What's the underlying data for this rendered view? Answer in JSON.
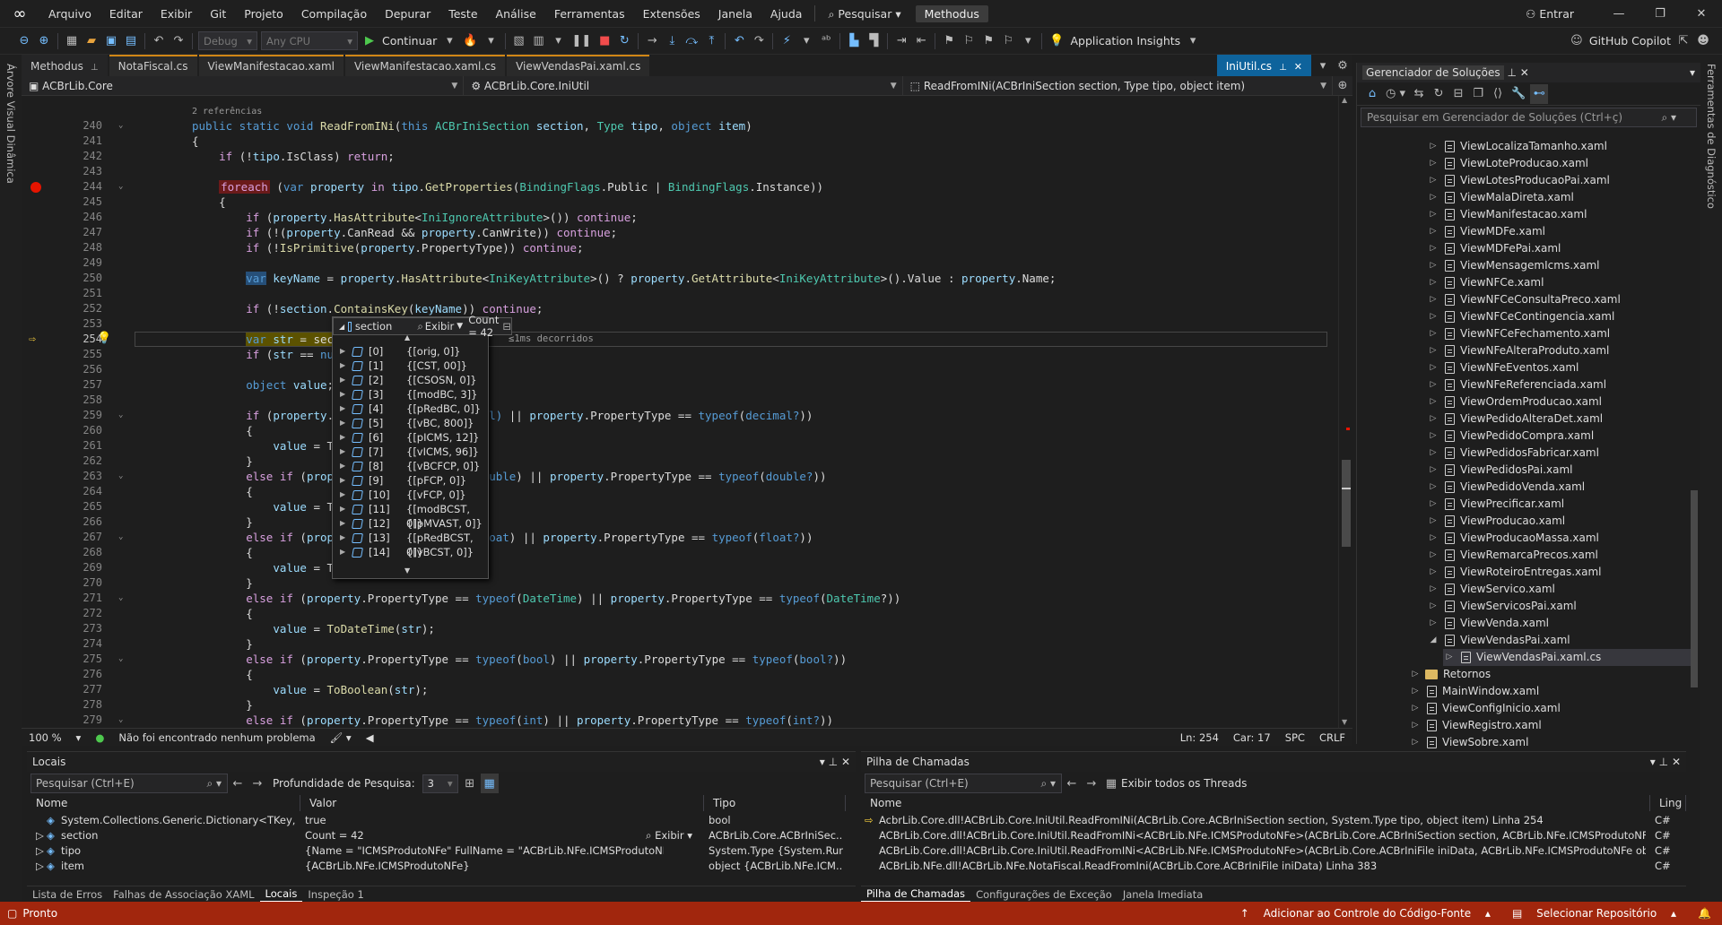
{
  "menu": {
    "items": [
      "Arquivo",
      "Editar",
      "Exibir",
      "Git",
      "Projeto",
      "Compilação",
      "Depurar",
      "Teste",
      "Análise",
      "Ferramentas",
      "Extensões",
      "Janela",
      "Ajuda"
    ],
    "search": "Pesquisar",
    "solution": "Methodus",
    "signin": "Entrar"
  },
  "toolbar": {
    "config": "Debug",
    "platform": "Any CPU",
    "continue": "Continuar",
    "insights": "Application Insights",
    "copilot": "GitHub Copilot"
  },
  "rails": {
    "left": "Árvore Visual Dinâmica",
    "right": "Ferramentas de Diagnóstico"
  },
  "tabs": [
    {
      "label": "Methodus",
      "style": "plain",
      "pin": "⊥"
    },
    {
      "label": "NotaFiscal.cs",
      "style": "orange"
    },
    {
      "label": "ViewManifestacao.xaml",
      "style": "orange"
    },
    {
      "label": "ViewManifestacao.xaml.cs",
      "style": "orange"
    },
    {
      "label": "ViewVendasPai.xaml.cs",
      "style": "orange"
    }
  ],
  "active_tab": {
    "label": "IniUtil.cs"
  },
  "navbar": {
    "project": "ACBrLib.Core",
    "class": "ACBrLib.Core.IniUtil",
    "member": "ReadFromINi(ACBrIniSection section, Type tipo, object item)"
  },
  "code": {
    "codelens": "2 referências",
    "elapsed": "≤1ms decorridos",
    "lines": [
      "240",
      "241",
      "242",
      "243",
      "244",
      "245",
      "246",
      "247",
      "248",
      "249",
      "250",
      "251",
      "252",
      "253",
      "254",
      "255",
      "256",
      "257",
      "258",
      "259",
      "260",
      "261",
      "262",
      "263",
      "264",
      "265",
      "266",
      "267",
      "268",
      "269",
      "270",
      "271",
      "272",
      "273",
      "274",
      "275",
      "276",
      "277",
      "278",
      "279"
    ]
  },
  "datatip": {
    "name": "section",
    "view": "Exibir",
    "count": "Count = 42",
    "items": [
      {
        "i": "[0]",
        "v": "{[orig, 0]}"
      },
      {
        "i": "[1]",
        "v": "{[CST, 00]}"
      },
      {
        "i": "[2]",
        "v": "{[CSOSN, 0]}"
      },
      {
        "i": "[3]",
        "v": "{[modBC, 3]}"
      },
      {
        "i": "[4]",
        "v": "{[pRedBC, 0]}"
      },
      {
        "i": "[5]",
        "v": "{[vBC, 800]}"
      },
      {
        "i": "[6]",
        "v": "{[pICMS, 12]}"
      },
      {
        "i": "[7]",
        "v": "{[vICMS, 96]}"
      },
      {
        "i": "[8]",
        "v": "{[vBCFCP, 0]}"
      },
      {
        "i": "[9]",
        "v": "{[pFCP, 0]}"
      },
      {
        "i": "[10]",
        "v": "{[vFCP, 0]}"
      },
      {
        "i": "[11]",
        "v": "{[modBCST, 0]}"
      },
      {
        "i": "[12]",
        "v": "{[pMVAST, 0]}"
      },
      {
        "i": "[13]",
        "v": "{[pRedBCST, 0]}"
      },
      {
        "i": "[14]",
        "v": "{[vBCST, 0]}"
      }
    ]
  },
  "editor_status": {
    "zoom": "100 %",
    "problems": "Não foi encontrado nenhum problema",
    "ln": "Ln: 254",
    "car": "Car: 17",
    "spc": "SPC",
    "crlf": "CRLF"
  },
  "solution": {
    "title": "Gerenciador de Soluções",
    "search": "Pesquisar em Gerenciador de Soluções (Ctrl+ç)",
    "items": [
      {
        "label": "ViewLocalizaTamanho.xaml",
        "lvl": 1,
        "kind": "file"
      },
      {
        "label": "ViewLoteProducao.xaml",
        "lvl": 1,
        "kind": "file"
      },
      {
        "label": "ViewLotesProducaoPai.xaml",
        "lvl": 1,
        "kind": "file"
      },
      {
        "label": "ViewMalaDireta.xaml",
        "lvl": 1,
        "kind": "file"
      },
      {
        "label": "ViewManifestacao.xaml",
        "lvl": 1,
        "kind": "file"
      },
      {
        "label": "ViewMDFe.xaml",
        "lvl": 1,
        "kind": "file"
      },
      {
        "label": "ViewMDFePai.xaml",
        "lvl": 1,
        "kind": "file"
      },
      {
        "label": "ViewMensagemIcms.xaml",
        "lvl": 1,
        "kind": "file"
      },
      {
        "label": "ViewNFCe.xaml",
        "lvl": 1,
        "kind": "file"
      },
      {
        "label": "ViewNFCeConsultaPreco.xaml",
        "lvl": 1,
        "kind": "file"
      },
      {
        "label": "ViewNFCeContingencia.xaml",
        "lvl": 1,
        "kind": "file"
      },
      {
        "label": "ViewNFCeFechamento.xaml",
        "lvl": 1,
        "kind": "file"
      },
      {
        "label": "ViewNFeAlteraProduto.xaml",
        "lvl": 1,
        "kind": "file"
      },
      {
        "label": "ViewNFeEventos.xaml",
        "lvl": 1,
        "kind": "file"
      },
      {
        "label": "ViewNFeReferenciada.xaml",
        "lvl": 1,
        "kind": "file"
      },
      {
        "label": "ViewOrdemProducao.xaml",
        "lvl": 1,
        "kind": "file"
      },
      {
        "label": "ViewPedidoAlteraDet.xaml",
        "lvl": 1,
        "kind": "file"
      },
      {
        "label": "ViewPedidoCompra.xaml",
        "lvl": 1,
        "kind": "file"
      },
      {
        "label": "ViewPedidosFabricar.xaml",
        "lvl": 1,
        "kind": "file"
      },
      {
        "label": "ViewPedidosPai.xaml",
        "lvl": 1,
        "kind": "file"
      },
      {
        "label": "ViewPedidoVenda.xaml",
        "lvl": 1,
        "kind": "file"
      },
      {
        "label": "ViewPrecificar.xaml",
        "lvl": 1,
        "kind": "file"
      },
      {
        "label": "ViewProducao.xaml",
        "lvl": 1,
        "kind": "file"
      },
      {
        "label": "ViewProducaoMassa.xaml",
        "lvl": 1,
        "kind": "file"
      },
      {
        "label": "ViewRemarcaPrecos.xaml",
        "lvl": 1,
        "kind": "file"
      },
      {
        "label": "ViewRoteiroEntregas.xaml",
        "lvl": 1,
        "kind": "file"
      },
      {
        "label": "ViewServico.xaml",
        "lvl": 1,
        "kind": "file"
      },
      {
        "label": "ViewServicosPai.xaml",
        "lvl": 1,
        "kind": "file"
      },
      {
        "label": "ViewVenda.xaml",
        "lvl": 1,
        "kind": "file"
      },
      {
        "label": "ViewVendasPai.xaml",
        "lvl": 1,
        "kind": "file",
        "open": true
      },
      {
        "label": "ViewVendasPai.xaml.cs",
        "lvl": 2,
        "kind": "file",
        "selected": true
      },
      {
        "label": "Retornos",
        "lvl": 0,
        "kind": "folder"
      },
      {
        "label": "MainWindow.xaml",
        "lvl": 0,
        "kind": "file"
      },
      {
        "label": "ViewConfigInicio.xaml",
        "lvl": 0,
        "kind": "file"
      },
      {
        "label": "ViewRegistro.xaml",
        "lvl": 0,
        "kind": "file"
      },
      {
        "label": "ViewSobre.xaml",
        "lvl": 0,
        "kind": "file"
      }
    ]
  },
  "locals": {
    "title": "Locais",
    "search": "Pesquisar (Ctrl+E)",
    "depth_label": "Profundidade de Pesquisa:",
    "depth": "3",
    "cols": [
      "Nome",
      "Valor",
      "Tipo"
    ],
    "rows": [
      {
        "name": "System.Collections.Generic.Dictionary<TKey, T...",
        "value": "true",
        "type": "bool"
      },
      {
        "name": "section",
        "value": "Count = 42",
        "view": "Exibir",
        "type": "ACBrLib.Core.ACBrIniSec..."
      },
      {
        "name": "tipo",
        "value": "{Name = \"ICMSProdutoNFe\" FullName = \"ACBrLib.NFe.ICMSProdutoNFe\"}",
        "type": "System.Type {System.Run..."
      },
      {
        "name": "item",
        "value": "{ACBrLib.NFe.ICMSProdutoNFe}",
        "type": "object {ACBrLib.NFe.ICM..."
      }
    ],
    "tabs": [
      "Lista de Erros",
      "Falhas de Associação XAML",
      "Locais",
      "Inspeção 1"
    ]
  },
  "callstack": {
    "title": "Pilha de Chamadas",
    "search": "Pesquisar (Ctrl+E)",
    "threads": "Exibir todos os Threads",
    "cols": [
      "Nome",
      "Ling"
    ],
    "rows": [
      {
        "name": "AcbrLib.Core.dll!ACBrLib.Core.IniUtil.ReadFromINi(ACBrLib.Core.ACBrIniSection section, System.Type tipo, object item) Linha 254",
        "lang": "C#"
      },
      {
        "name": "ACBrLib.Core.dll!ACBrLib.Core.IniUtil.ReadFromINi<ACBrLib.NFe.ICMSProdutoNFe>(ACBrLib.Core.ACBrIniSection section, ACBrLib.NFe.ICMSProdutoNFe item) L...",
        "lang": "C#"
      },
      {
        "name": "ACBrLib.Core.dll!ACBrLib.Core.IniUtil.ReadFromINi<ACBrLib.NFe.ICMSProdutoNFe>(ACBrLib.Core.ACBrIniFile iniData, ACBrLib.NFe.ICMSProdutoNFe obj, string s...",
        "lang": "C#"
      },
      {
        "name": "ACBrLib.NFe.dll!ACBrLib.NFe.NotaFiscal.ReadFromIni(ACBrLib.Core.ACBrIniFile iniData) Linha 383",
        "lang": "C#"
      }
    ],
    "tabs": [
      "Pilha de Chamadas",
      "Configurações de Exceção",
      "Janela Imediata"
    ]
  },
  "statusbar": {
    "ready": "Pronto",
    "git": "Adicionar ao Controle do Código-Fonte",
    "repo": "Selecionar Repositório"
  }
}
